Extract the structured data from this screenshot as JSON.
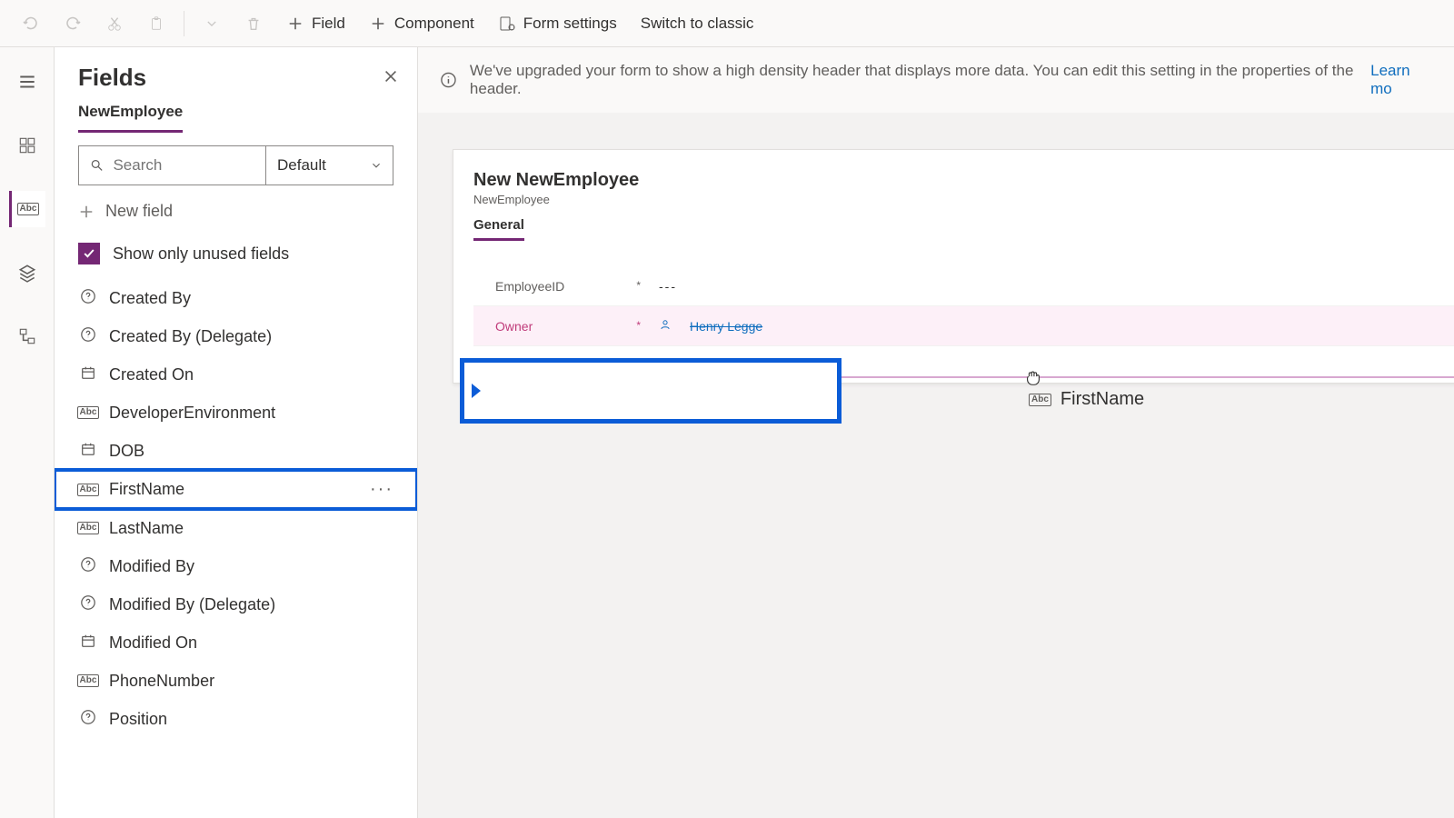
{
  "toolbar": {
    "field_label": "Field",
    "component_label": "Component",
    "form_settings_label": "Form settings",
    "switch_label": "Switch to classic"
  },
  "panel": {
    "title": "Fields",
    "tab": "NewEmployee",
    "search_placeholder": "Search",
    "sort_label": "Default",
    "new_field_label": "New field",
    "show_unused_label": "Show only unused fields"
  },
  "fields": [
    {
      "type": "lookup",
      "label": "Created By"
    },
    {
      "type": "lookup",
      "label": "Created By (Delegate)"
    },
    {
      "type": "date",
      "label": "Created On"
    },
    {
      "type": "text",
      "label": "DeveloperEnvironment"
    },
    {
      "type": "date",
      "label": "DOB"
    },
    {
      "type": "text",
      "label": "FirstName",
      "selected": true
    },
    {
      "type": "text",
      "label": "LastName"
    },
    {
      "type": "lookup",
      "label": "Modified By"
    },
    {
      "type": "lookup",
      "label": "Modified By (Delegate)"
    },
    {
      "type": "date",
      "label": "Modified On"
    },
    {
      "type": "text",
      "label": "PhoneNumber"
    },
    {
      "type": "lookup",
      "label": "Position"
    }
  ],
  "banner": {
    "text": "We've upgraded your form to show a high density header that displays more data. You can edit this setting in the properties of the header.",
    "learn": "Learn mo"
  },
  "form": {
    "title": "New NewEmployee",
    "subtitle": "NewEmployee",
    "tab": "General",
    "rows": {
      "employee_id_label": "EmployeeID",
      "employee_id_value": "---",
      "owner_label": "Owner",
      "owner_value": "Henry Legge"
    }
  },
  "drag": {
    "ghost_label": "FirstName"
  }
}
